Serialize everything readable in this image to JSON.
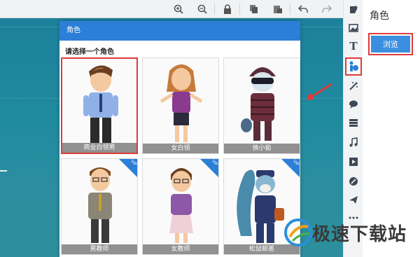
{
  "toolbar": {
    "tools": [
      {
        "name": "zoom-in-icon"
      },
      {
        "name": "zoom-out-icon"
      },
      {
        "name": "lock-icon"
      },
      {
        "name": "copy-icon"
      },
      {
        "name": "paste-icon"
      },
      {
        "name": "undo-icon"
      },
      {
        "name": "redo-icon"
      }
    ]
  },
  "iconbar": {
    "items": [
      "shapes-icon",
      "image-icon",
      "text-icon",
      "role-icon",
      "effects-icon",
      "bubble-icon",
      "layers-icon",
      "music-icon",
      "video-icon",
      "tools-icon",
      "plane-icon",
      "more-icon"
    ],
    "active": "role-icon"
  },
  "props": {
    "title": "角色",
    "browse_label": "浏览"
  },
  "dialog": {
    "header": "角色",
    "subtitle": "请选择一个角色",
    "characters": [
      {
        "name": "商业白领男",
        "selected": true,
        "vip": false
      },
      {
        "name": "女白领",
        "selected": false,
        "vip": false
      },
      {
        "name": "俠小偷",
        "selected": false,
        "vip": false
      },
      {
        "name": "男教师",
        "selected": false,
        "vip": true
      },
      {
        "name": "女教师",
        "selected": false,
        "vip": true
      },
      {
        "name": "松鼠邮差",
        "selected": false,
        "vip": true
      }
    ],
    "vip_label": "VIP"
  },
  "watermark": {
    "text": "极速下载站"
  },
  "colors": {
    "accent": "#2b7fd6",
    "highlight": "#e03a3a",
    "canvas": "#1f8a9e"
  }
}
